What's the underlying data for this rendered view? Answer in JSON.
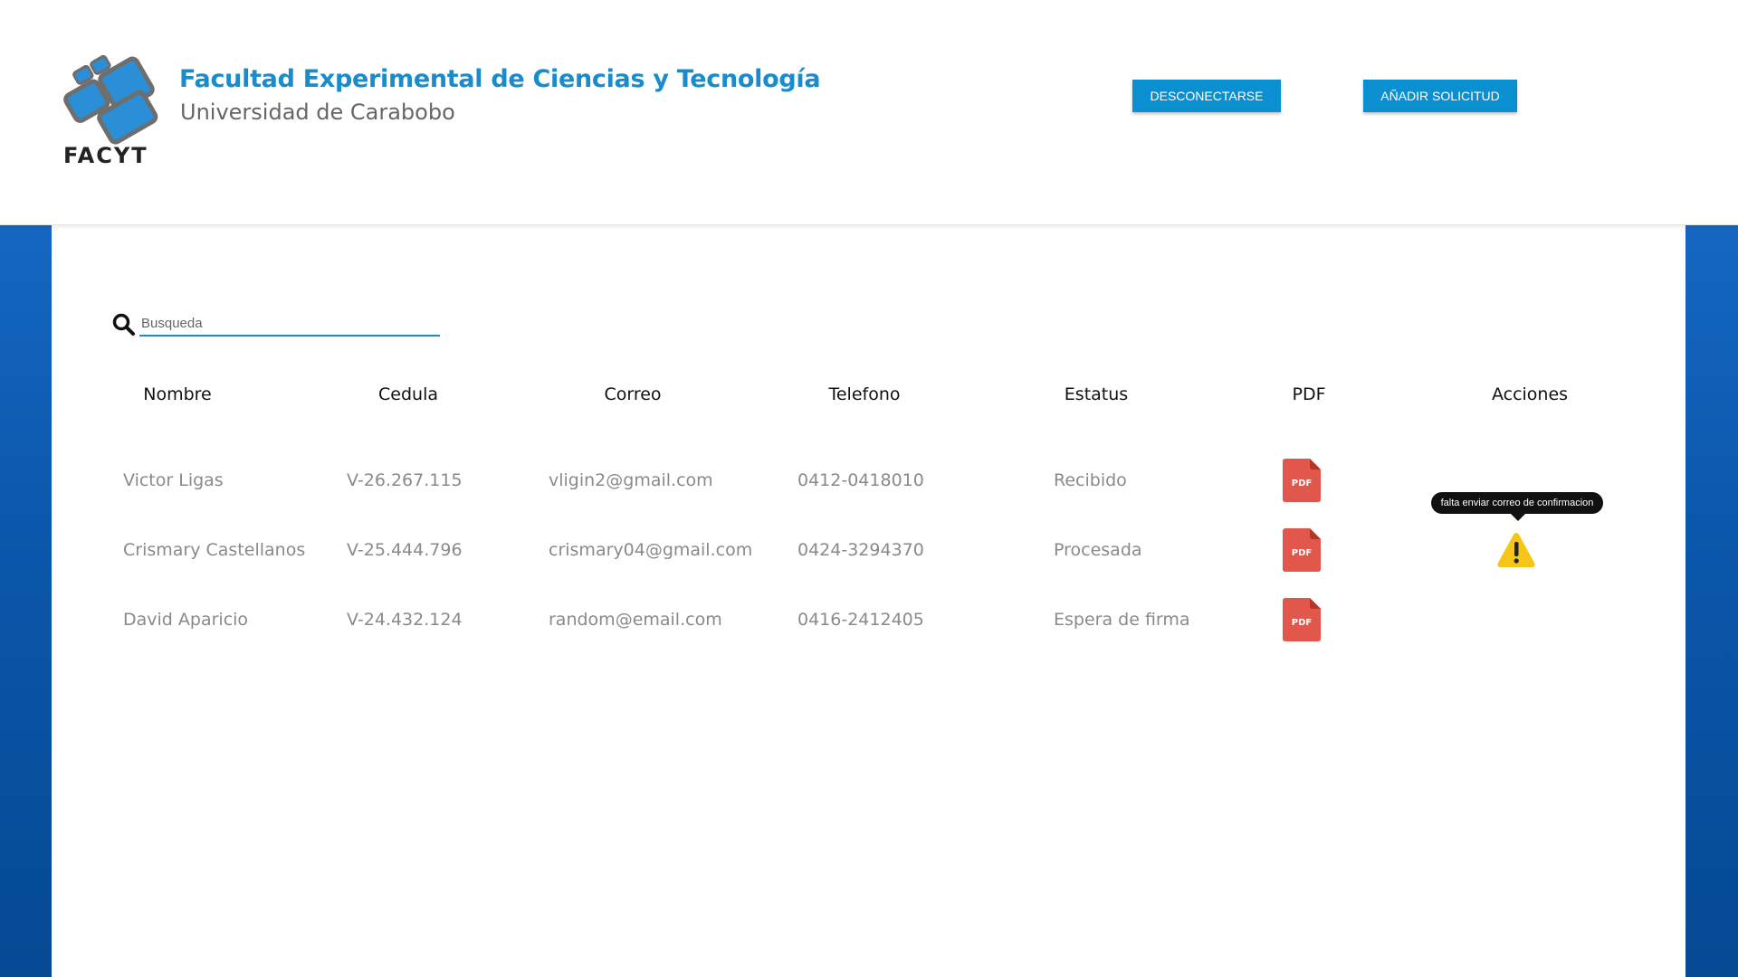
{
  "header": {
    "logo_title": "Facultad Experimental de Ciencias y Tecnología",
    "logo_subtitle": "Universidad de Carabobo",
    "logo_text": "FACYT",
    "logout_label": "DESCONECTARSE",
    "add_label": "AÑADIR SOLICITUD"
  },
  "search": {
    "placeholder": "Busqueda",
    "value": ""
  },
  "table": {
    "columns": [
      "Nombre",
      "Cedula",
      "Correo",
      "Telefono",
      "Estatus",
      "PDF",
      "Acciones"
    ],
    "rows": [
      {
        "nombre": "Victor Ligas",
        "cedula": "V-26.267.115",
        "correo": "vligin2@gmail.com",
        "telefono": "0412-0418010",
        "estatus": "Recibido",
        "pdf_label": "PDF"
      },
      {
        "nombre": "Crismary Castellanos",
        "cedula": "V-25.444.796",
        "correo": "crismary04@gmail.com",
        "telefono": "0424-3294370",
        "estatus": "Procesada",
        "pdf_label": "PDF"
      },
      {
        "nombre": "David Aparicio",
        "cedula": "V-24.432.124",
        "correo": "random@email.com",
        "telefono": "0416-2412405",
        "estatus": "Espera de firma",
        "pdf_label": "PDF"
      }
    ]
  },
  "tooltip": {
    "text": "falta enviar correo de confirmacion"
  },
  "icons": {
    "search": "search-icon",
    "pdf": "pdf-file-icon",
    "warning": "warning-icon"
  },
  "colors": {
    "accent": "#0a8fd0",
    "title_blue": "#1a8ccc",
    "pdf_red": "#e2574c",
    "warning_yellow": "#f5c518",
    "background_blue": "#0b57ab"
  }
}
